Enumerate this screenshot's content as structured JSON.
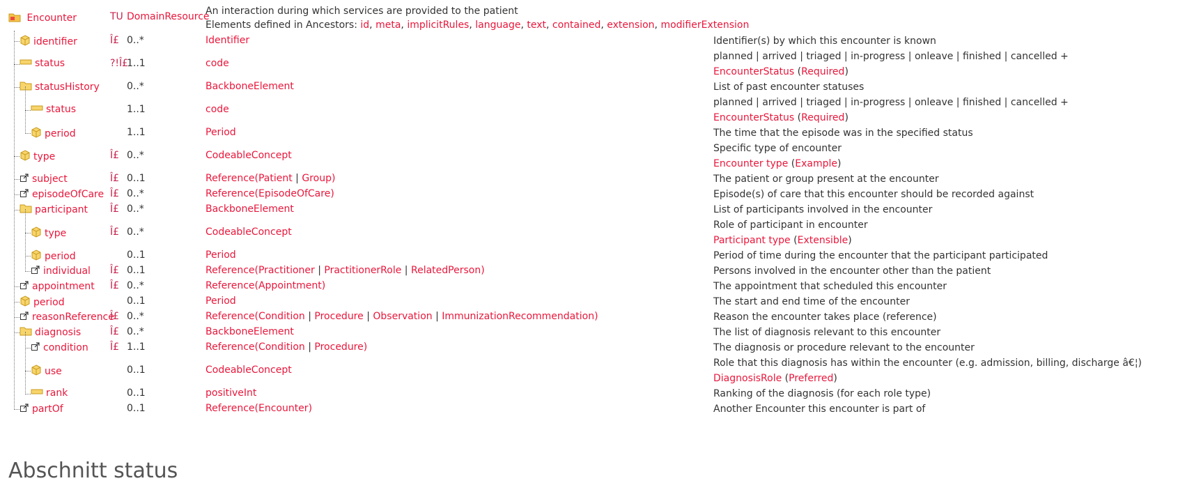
{
  "root": {
    "name": "Encounter",
    "flags": "TU",
    "type": "DomainResource",
    "desc_line1": "An interaction during which services are provided to the patient",
    "ancestors_prefix": "Elements defined in Ancestors: ",
    "ancestors": [
      "id",
      "meta",
      "implicitRules",
      "language",
      "text",
      "contained",
      "extension",
      "modifierExtension"
    ]
  },
  "rows": [
    {
      "name": "identifier",
      "icon": "datatype",
      "flags": "Î£",
      "card": "0..*",
      "type": [
        {
          "t": "Identifier",
          "link": true
        }
      ],
      "desc": "Identifier(s) by which this encounter is known",
      "binding": null
    },
    {
      "name": "status",
      "icon": "primitive",
      "flags": "?!Î£",
      "card": "1..1",
      "type": [
        {
          "t": "code",
          "link": true
        }
      ],
      "desc": "planned | arrived | triaged | in-progress | onleave | finished | cancelled +",
      "binding": {
        "name": "EncounterStatus",
        "strength": "Required"
      }
    },
    {
      "name": "statusHistory",
      "icon": "element",
      "flags": "",
      "card": "0..*",
      "type": [
        {
          "t": "BackboneElement",
          "link": true
        }
      ],
      "desc": "List of past encounter statuses",
      "binding": null
    },
    {
      "name": "status",
      "icon": "primitive",
      "flags": "",
      "card": "1..1",
      "type": [
        {
          "t": "code",
          "link": true
        }
      ],
      "desc": "planned | arrived | triaged | in-progress | onleave | finished | cancelled +",
      "binding": {
        "name": "EncounterStatus",
        "strength": "Required"
      }
    },
    {
      "name": "period",
      "icon": "datatype",
      "flags": "",
      "card": "1..1",
      "type": [
        {
          "t": "Period",
          "link": true
        }
      ],
      "desc": "The time that the episode was in the specified status",
      "binding": null
    },
    {
      "name": "type",
      "icon": "datatype",
      "flags": "Î£",
      "card": "0..*",
      "type": [
        {
          "t": "CodeableConcept",
          "link": true
        }
      ],
      "desc": "Specific type of encounter",
      "binding": {
        "name": "Encounter type",
        "strength": "Example"
      }
    },
    {
      "name": "subject",
      "icon": "reference",
      "flags": "Î£",
      "card": "0..1",
      "type": [
        {
          "t": "Reference(",
          "link": true
        },
        {
          "t": "Patient",
          "link": true
        },
        {
          "t": " | ",
          "link": false
        },
        {
          "t": "Group",
          "link": true
        },
        {
          "t": ")",
          "link": true
        }
      ],
      "desc": "The patient or group present at the encounter",
      "binding": null
    },
    {
      "name": "episodeOfCare",
      "icon": "reference",
      "flags": "Î£",
      "card": "0..*",
      "type": [
        {
          "t": "Reference(",
          "link": true
        },
        {
          "t": "EpisodeOfCare",
          "link": true
        },
        {
          "t": ")",
          "link": true
        }
      ],
      "desc": "Episode(s) of care that this encounter should be recorded against",
      "binding": null
    },
    {
      "name": "participant",
      "icon": "element",
      "flags": "Î£",
      "card": "0..*",
      "type": [
        {
          "t": "BackboneElement",
          "link": true
        }
      ],
      "desc": "List of participants involved in the encounter",
      "binding": null
    },
    {
      "name": "type",
      "icon": "datatype",
      "flags": "Î£",
      "card": "0..*",
      "type": [
        {
          "t": "CodeableConcept",
          "link": true
        }
      ],
      "desc": "Role of participant in encounter",
      "binding": {
        "name": "Participant type",
        "strength": "Extensible"
      }
    },
    {
      "name": "period",
      "icon": "datatype",
      "flags": "",
      "card": "0..1",
      "type": [
        {
          "t": "Period",
          "link": true
        }
      ],
      "desc": "Period of time during the encounter that the participant participated",
      "binding": null
    },
    {
      "name": "individual",
      "icon": "reference",
      "flags": "Î£",
      "card": "0..1",
      "type": [
        {
          "t": "Reference(",
          "link": true
        },
        {
          "t": "Practitioner",
          "link": true
        },
        {
          "t": " | ",
          "link": false
        },
        {
          "t": "PractitionerRole",
          "link": true
        },
        {
          "t": " | ",
          "link": false
        },
        {
          "t": "RelatedPerson",
          "link": true
        },
        {
          "t": ")",
          "link": true
        }
      ],
      "desc": "Persons involved in the encounter other than the patient",
      "binding": null
    },
    {
      "name": "appointment",
      "icon": "reference",
      "flags": "Î£",
      "card": "0..*",
      "type": [
        {
          "t": "Reference(",
          "link": true
        },
        {
          "t": "Appointment",
          "link": true
        },
        {
          "t": ")",
          "link": true
        }
      ],
      "desc": "The appointment that scheduled this encounter",
      "binding": null
    },
    {
      "name": "period",
      "icon": "datatype",
      "flags": "",
      "card": "0..1",
      "type": [
        {
          "t": "Period",
          "link": true
        }
      ],
      "desc": "The start and end time of the encounter",
      "binding": null
    },
    {
      "name": "reasonReference",
      "icon": "reference",
      "flags": "Î£",
      "card": "0..*",
      "type": [
        {
          "t": "Reference(",
          "link": true
        },
        {
          "t": "Condition",
          "link": true
        },
        {
          "t": " | ",
          "link": false
        },
        {
          "t": "Procedure",
          "link": true
        },
        {
          "t": " | ",
          "link": false
        },
        {
          "t": "Observation",
          "link": true
        },
        {
          "t": " | ",
          "link": false
        },
        {
          "t": "ImmunizationRecommendation",
          "link": true
        },
        {
          "t": ")",
          "link": true
        }
      ],
      "desc": "Reason the encounter takes place (reference)",
      "binding": null
    },
    {
      "name": "diagnosis",
      "icon": "element",
      "flags": "Î£",
      "card": "0..*",
      "type": [
        {
          "t": "BackboneElement",
          "link": true
        }
      ],
      "desc": "The list of diagnosis relevant to this encounter",
      "binding": null
    },
    {
      "name": "condition",
      "icon": "reference",
      "flags": "Î£",
      "card": "1..1",
      "type": [
        {
          "t": "Reference(",
          "link": true
        },
        {
          "t": "Condition",
          "link": true
        },
        {
          "t": " | ",
          "link": false
        },
        {
          "t": "Procedure",
          "link": true
        },
        {
          "t": ")",
          "link": true
        }
      ],
      "desc": "The diagnosis or procedure relevant to the encounter",
      "binding": null
    },
    {
      "name": "use",
      "icon": "datatype",
      "flags": "",
      "card": "0..1",
      "type": [
        {
          "t": "CodeableConcept",
          "link": true
        }
      ],
      "desc": "Role that this diagnosis has within the encounter (e.g. admission, billing, discharge â€¦)",
      "binding": {
        "name": "DiagnosisRole",
        "strength": "Preferred"
      }
    },
    {
      "name": "rank",
      "icon": "primitive",
      "flags": "",
      "card": "0..1",
      "type": [
        {
          "t": "positiveInt",
          "link": true
        }
      ],
      "desc": "Ranking of the diagnosis (for each role type)",
      "binding": null
    },
    {
      "name": "partOf",
      "icon": "reference",
      "flags": "",
      "card": "0..1",
      "type": [
        {
          "t": "Reference(",
          "link": true
        },
        {
          "t": "Encounter",
          "link": true
        },
        {
          "t": ")",
          "link": true
        }
      ],
      "desc": "Another Encounter this encounter is part of",
      "binding": null
    }
  ],
  "next_heading": "Abschnitt status"
}
